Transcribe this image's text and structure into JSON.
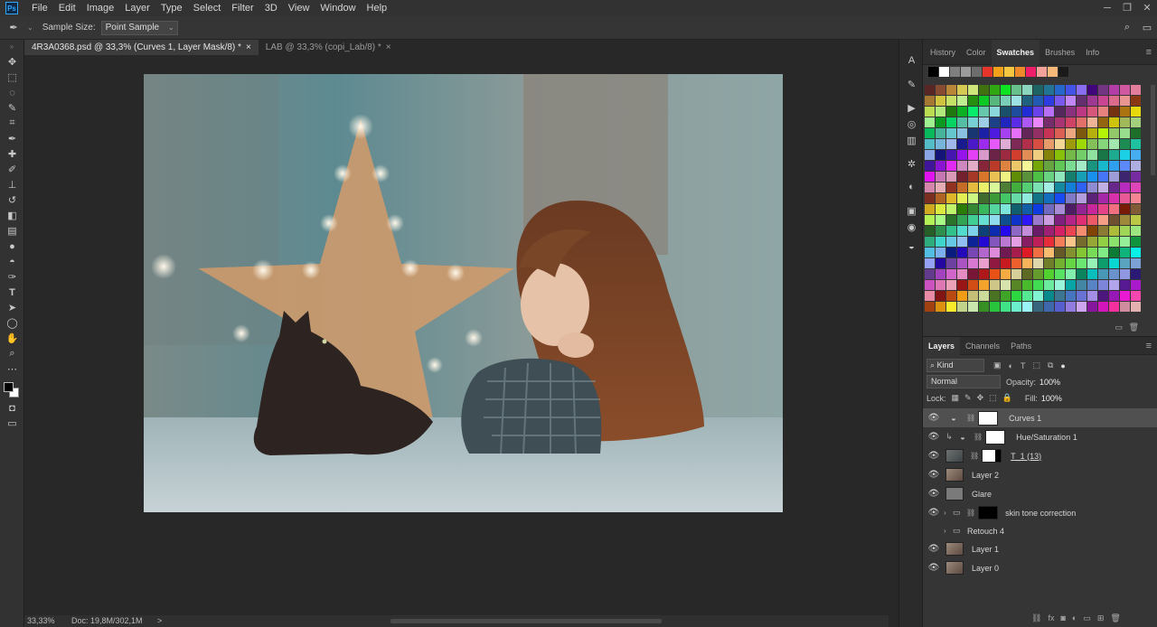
{
  "menu": [
    "File",
    "Edit",
    "Image",
    "Layer",
    "Type",
    "Select",
    "Filter",
    "3D",
    "View",
    "Window",
    "Help"
  ],
  "options": {
    "sample_size_label": "Sample Size:",
    "sample_size_value": "Point Sample"
  },
  "tabs": [
    {
      "label": "4R3A0368.psd @ 33,3% (Curves 1, Layer Mask/8) *",
      "close": "×"
    },
    {
      "label": "LAB @ 33,3% (copi_Lab/8) *",
      "close": "×"
    }
  ],
  "status": {
    "zoom": "33,33%",
    "doc": "Doc: 19,8M/302,1M",
    "arrow": ">"
  },
  "top_panel": {
    "tabs": [
      "History",
      "Color",
      "Swatches",
      "Brushes",
      "Info"
    ],
    "active": "Swatches"
  },
  "layers_panel": {
    "tabs": [
      "Layers",
      "Channels",
      "Paths"
    ],
    "filter": "Kind",
    "blend_mode": "Normal",
    "opacity_label": "Opacity:",
    "opacity_value": "100%",
    "lock_label": "Lock:",
    "fill_label": "Fill:",
    "fill_value": "100%",
    "layers": [
      {
        "name": "Curves 1",
        "type": "adjustment",
        "selected": true
      },
      {
        "name": "Hue/Saturation 1",
        "type": "adjustment-clipped",
        "selected": false
      },
      {
        "name": "T_1 (13)",
        "type": "masked",
        "selected": false
      },
      {
        "name": "Layer 2",
        "type": "pixel",
        "selected": false
      },
      {
        "name": "Glare",
        "type": "pixel",
        "selected": false
      },
      {
        "name": "skin tone correction",
        "type": "group-mask",
        "selected": false
      },
      {
        "name": "Retouch 4",
        "type": "group",
        "selected": false
      },
      {
        "name": "Layer 1",
        "type": "pixel",
        "selected": false
      },
      {
        "name": "Layer 0",
        "type": "pixel",
        "selected": false
      }
    ]
  },
  "colors": {
    "accent": "#31a8ff",
    "bg": "#282828",
    "panel": "#353535"
  }
}
